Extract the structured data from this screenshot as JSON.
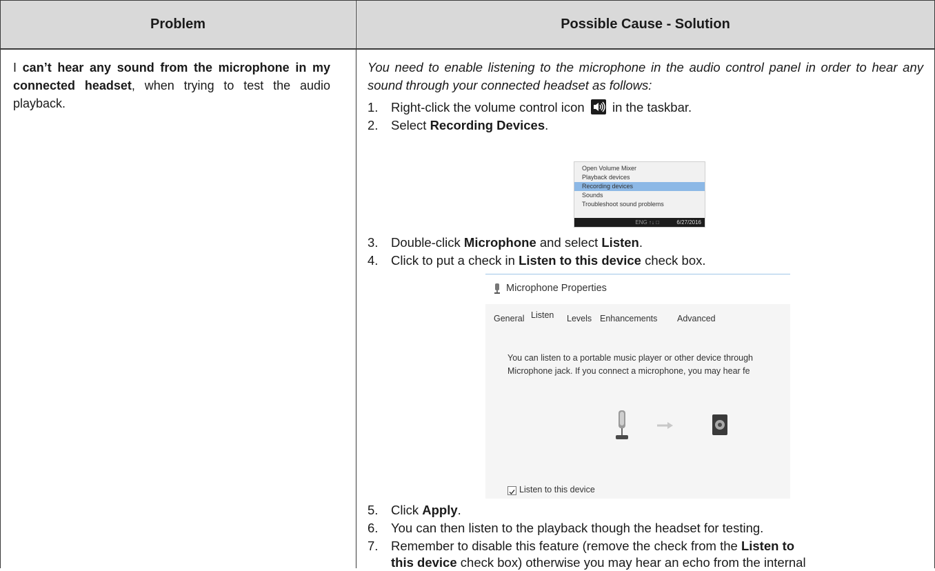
{
  "header": {
    "problem": "Problem",
    "solution": "Possible Cause - Solution"
  },
  "problem": {
    "prefix": "I ",
    "bold": "can’t hear any sound from the microphone in my connected headset",
    "suffix": ", when trying to test the audio playback."
  },
  "solution": {
    "intro": "You need to enable listening to the microphone in the audio control panel in order to hear any sound through your connected headset as follows:",
    "steps": [
      {
        "num": "1.",
        "pre": "Right-click the volume control icon ",
        "bold": "",
        "post": " in the taskbar."
      },
      {
        "num": "2.",
        "pre": "Select ",
        "bold": "Recording Devices",
        "post": "."
      },
      {
        "num": "3.",
        "pre": "Double-click ",
        "bold": "Microphone",
        "mid": " and select ",
        "bold2": "Listen",
        "post": "."
      },
      {
        "num": "4.",
        "pre": "Click to put a check in ",
        "bold": "Listen to this device",
        "post": " check box."
      },
      {
        "num": "5.",
        "pre": "Click ",
        "bold": "Apply",
        "post": "."
      },
      {
        "num": "6.",
        "pre": "You can then listen to the playback though the headset for testing.",
        "bold": "",
        "post": ""
      },
      {
        "num": "7.",
        "pre": "Remember to disable this feature (remove the check from the ",
        "bold": "Listen to",
        "post": ""
      }
    ],
    "step7_line2": {
      "bold": "this device",
      "post": " check box) otherwise you may hear an echo from the internal"
    }
  },
  "context_menu": {
    "items": [
      "Open Volume Mixer",
      "Playback devices",
      "Recording devices",
      "Sounds",
      "Troubleshoot sound problems"
    ],
    "selected_index": 2,
    "tray_text": "ENG  ↑↓  □",
    "date": "6/27/2016"
  },
  "mic_dialog": {
    "title": "Microphone Properties",
    "tabs": [
      "General",
      "Listen",
      "Levels",
      "Enhancements",
      "Advanced"
    ],
    "active_tab": "Listen",
    "text_line1": "You can listen to a portable music player or other device through",
    "text_line2": "Microphone jack.  If you connect a microphone, you may hear fe",
    "checkbox_label": "Listen to this device",
    "checkbox_checked": true
  }
}
